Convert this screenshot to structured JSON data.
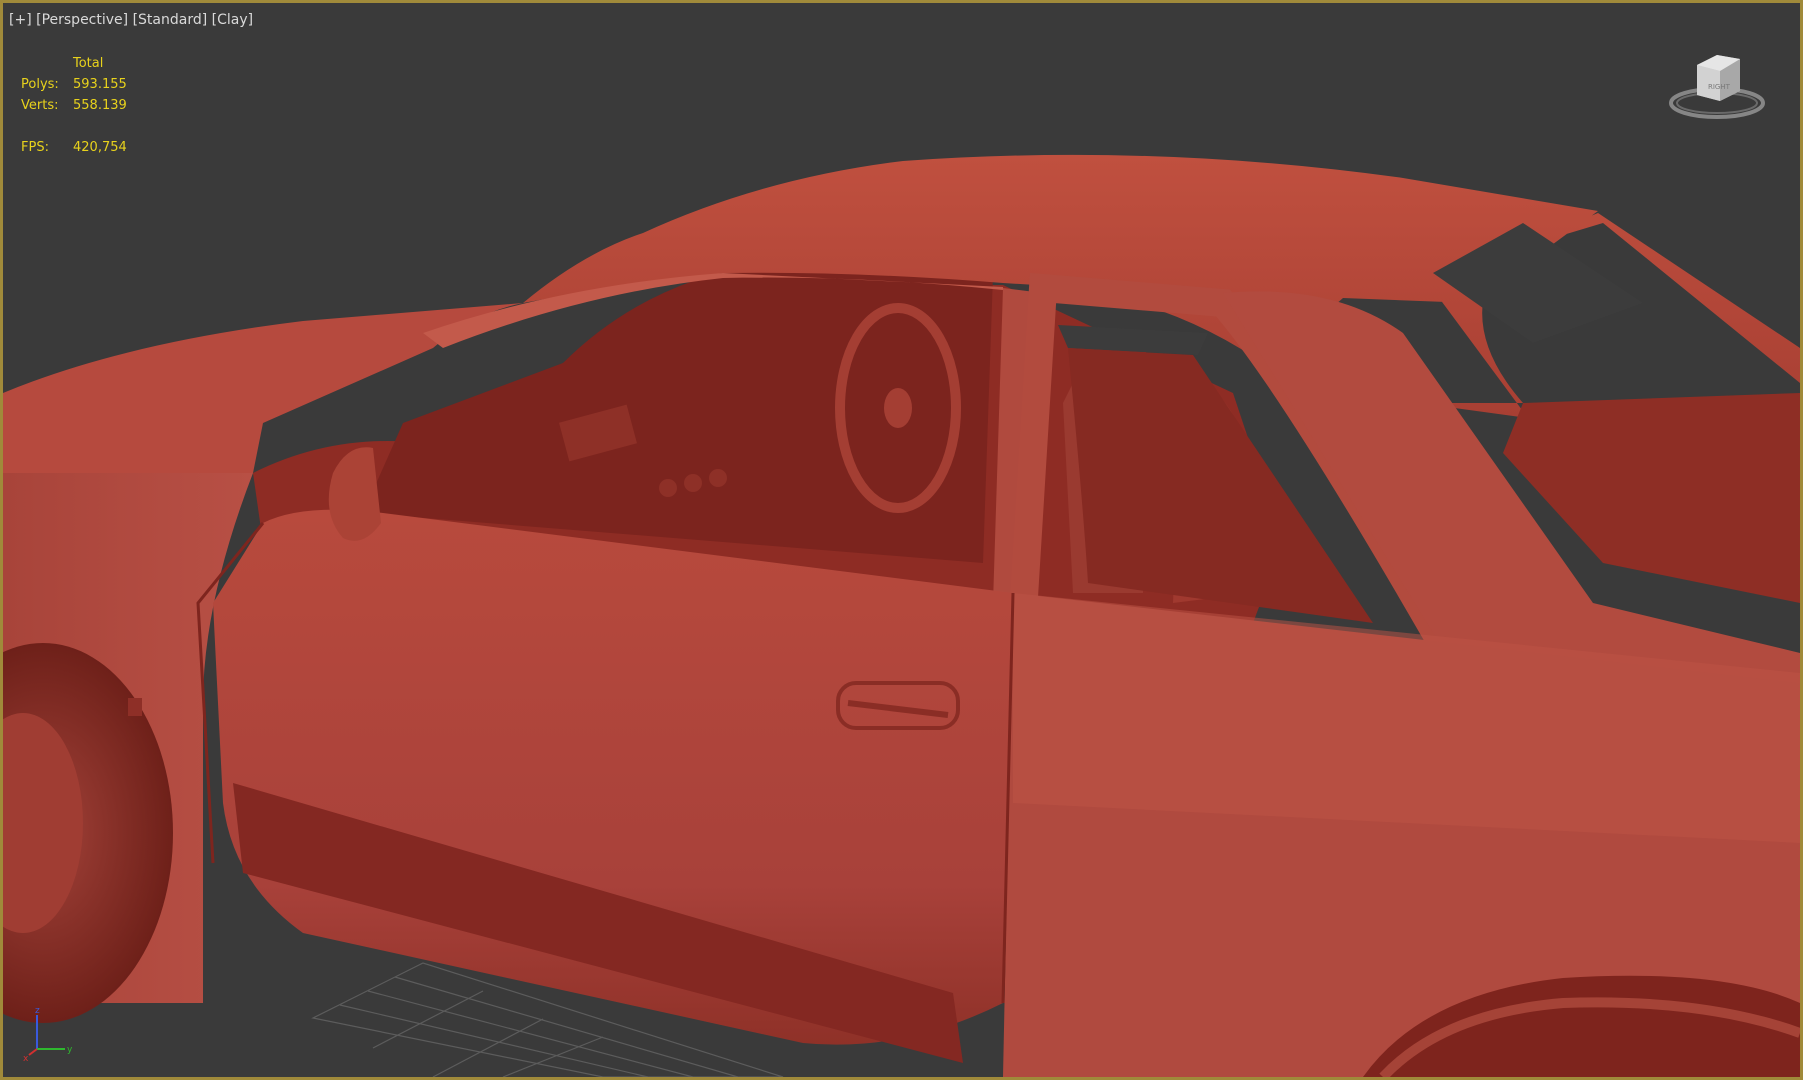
{
  "viewport": {
    "label_plus": "[+]",
    "label_view": "[Perspective]",
    "label_shading": "[Standard]",
    "label_style": "[Clay]"
  },
  "stats": {
    "header": "Total",
    "polys_label": "Polys:",
    "polys_value": "593.155",
    "verts_label": "Verts:",
    "verts_value": "558.139",
    "fps_label": "FPS:",
    "fps_value": "420,754"
  },
  "viewcube": {
    "face_label": "RIGHT"
  },
  "axes": {
    "z": "z",
    "y": "y",
    "x": "x"
  },
  "colors": {
    "background": "#3a3a3a",
    "border": "#a08a3a",
    "stats_text": "#e8d21c",
    "clay_body": "#b4473c",
    "clay_shadow": "#8a2a22",
    "clay_highlight": "#c75a4c"
  }
}
